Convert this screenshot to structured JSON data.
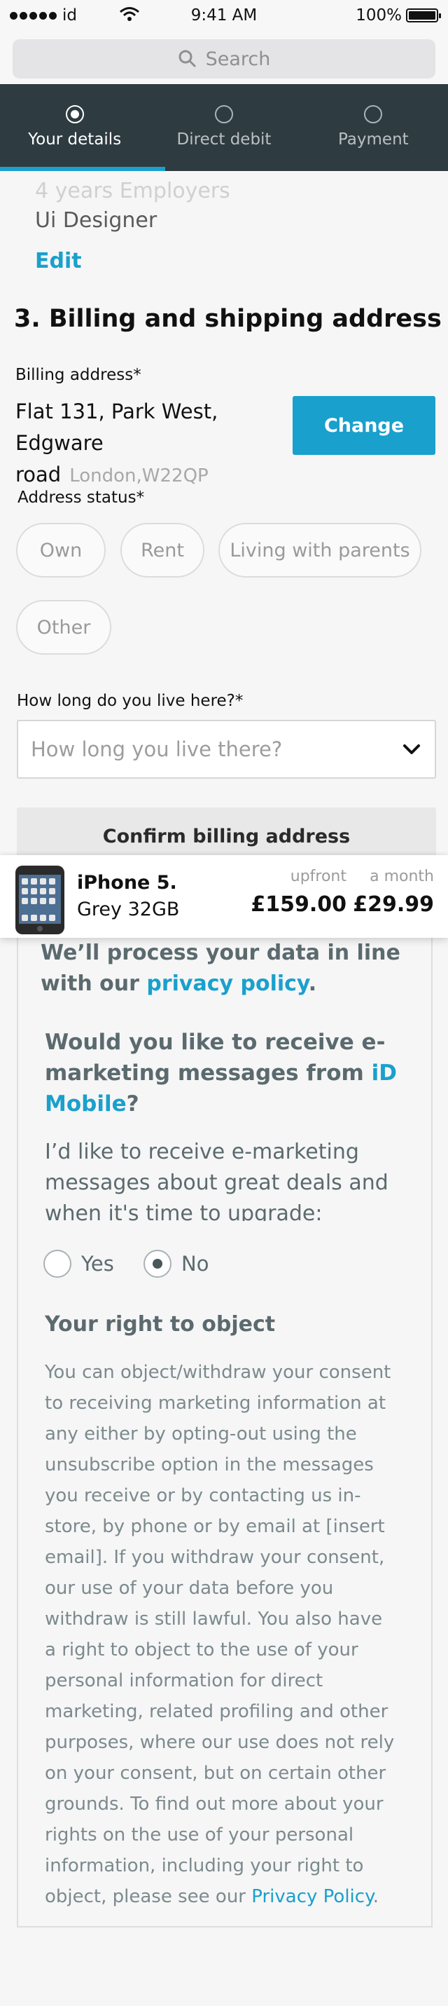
{
  "status_bar": {
    "carrier": "id",
    "time": "9:41 AM",
    "battery": "100%",
    "battery_level": 1.0
  },
  "search": {
    "placeholder": "Search",
    "icon": "search-icon"
  },
  "stepper": {
    "steps": [
      {
        "label": "Your details",
        "active": true
      },
      {
        "label": "Direct debit",
        "active": false
      },
      {
        "label": "Payment",
        "active": false
      }
    ]
  },
  "previous_section": {
    "employers_text": "4 years Employers",
    "role": "Ui Designer",
    "edit_label": "Edit"
  },
  "billing": {
    "section_title": "3. Billing and shipping address",
    "billing_label": "Billing address*",
    "address_line": "Flat 131, Park West, Edgware road",
    "address_city": "London,W22QP",
    "change_label": "Change",
    "status_label": "Address status*",
    "status_options": [
      "Own",
      "Rent",
      "Living with parents",
      "Other"
    ],
    "howlong_label": "How long do you live here?*",
    "howlong_placeholder": "How long you live there?",
    "confirm_label": "Confirm billing address"
  },
  "product": {
    "name": "iPhone 5.",
    "spec": "Grey 32GB",
    "upfront_label": "upfront",
    "upfront_price": "£159.00",
    "monthly_label": "a month",
    "monthly_price": "£29.99"
  },
  "marketing": {
    "intro_text": "We’ll process your data in line with our ",
    "intro_link": "privacy policy",
    "intro_end": ".",
    "question_text": "Would you like to receive e-marketing messages from ",
    "question_link": "iD Mobile",
    "question_end": "?",
    "consent_text": "I’d like to receive e-marketing messages about great deals and when it's time to upgrade:",
    "option_yes": "Yes",
    "option_no": "No",
    "selected": "No",
    "right_title": "Your right to object",
    "right_body": "You can object/withdraw your consent to receiving marketing information at any either by opting-out using the unsubscribe option in the messages you receive or by contacting us in-store, by phone or by email at [insert email]. If you withdraw your consent, our use of your data before you withdraw is still lawful. You also have a right to object to the use of your personal information for direct marketing, related profiling and other purposes, where our use does not rely on your consent, but on certain other grounds. To find out more about your rights on the use of your personal information, including your right to object, please see our ",
    "right_link": "Privacy Policy",
    "right_end": "."
  },
  "colors": {
    "accent": "#1aa0cc",
    "stepper_bg": "#2e3b40",
    "text_muted": "#5b6a6e"
  }
}
